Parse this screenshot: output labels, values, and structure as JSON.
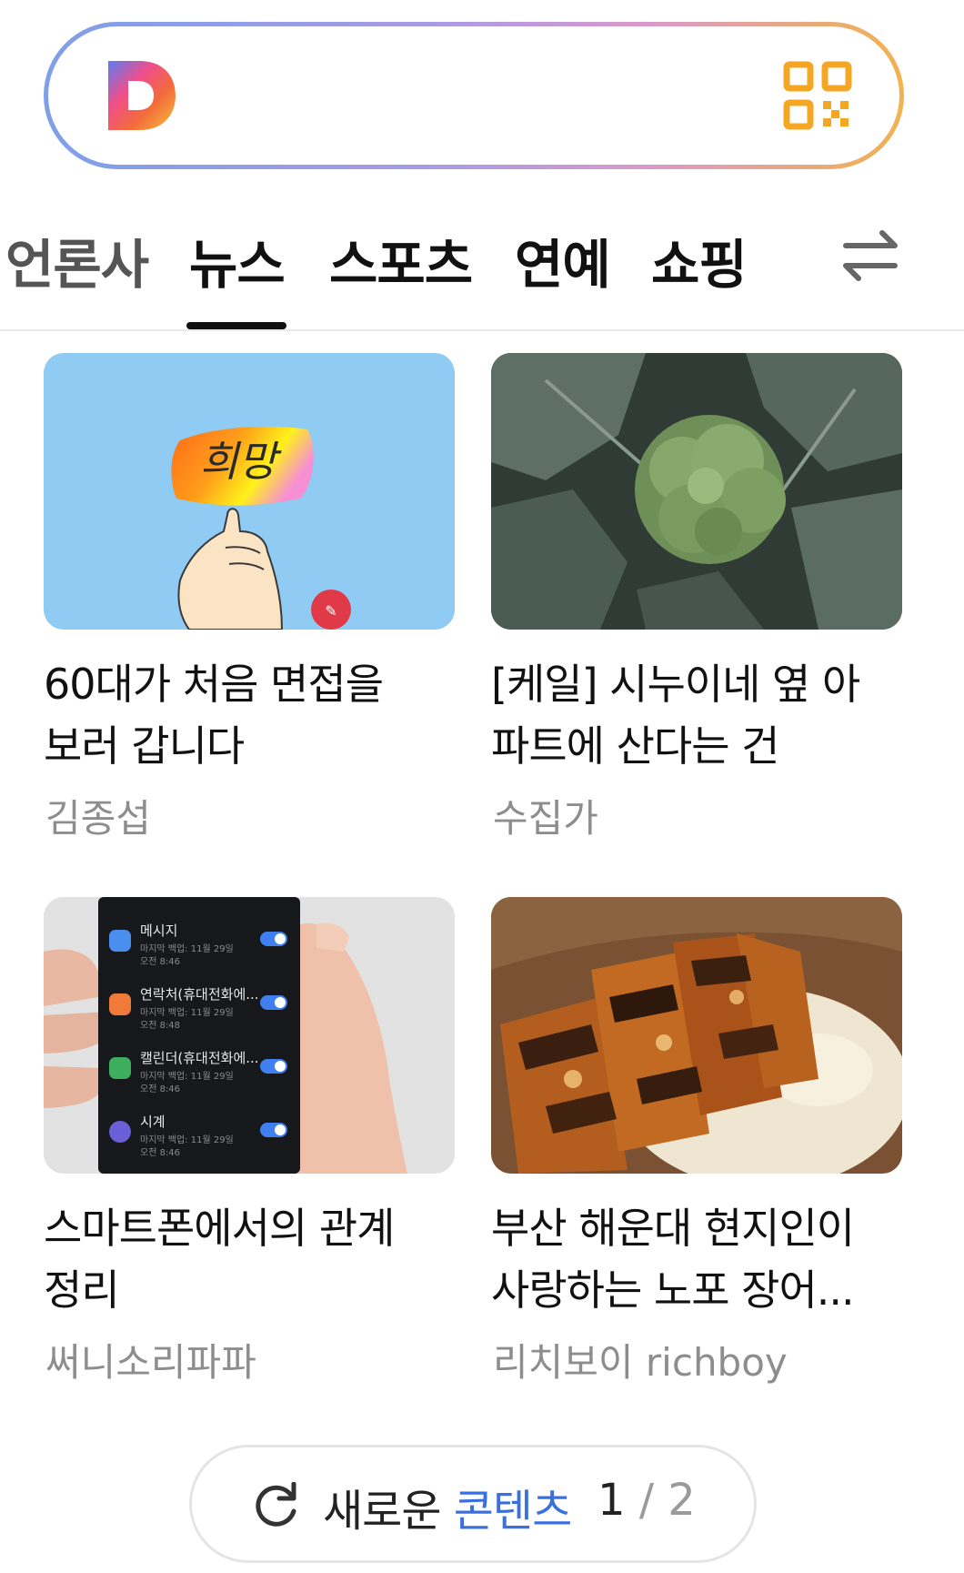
{
  "search": {
    "logo_letter": "D",
    "qr_icon": "qr-code-icon"
  },
  "tabs": {
    "items": [
      {
        "label": "언론사"
      },
      {
        "label": "뉴스",
        "active": true
      },
      {
        "label": "스포츠"
      },
      {
        "label": "연예"
      },
      {
        "label": "쇼핑"
      }
    ],
    "swap_icon": "swap-arrows-icon"
  },
  "cards": [
    {
      "title_line1": "60대가 처음 면접을",
      "title_line2": "보러 갑니다",
      "source": "김종섭",
      "image_text": "희망"
    },
    {
      "title_line1": "[케일] 시누이네 옆 아",
      "title_line2": "파트에 산다는 건",
      "source": "수집가"
    },
    {
      "title_line1": "스마트폰에서의 관계",
      "title_line2": "정리",
      "source": "써니소리파파",
      "phone_items": [
        {
          "name": "메시지",
          "meta": "마지막 백업: 11월 29일",
          "time": "오전 8:46"
        },
        {
          "name": "연락처(휴대전화에...",
          "meta": "마지막 백업: 11월 29일",
          "time": "오전 8:48"
        },
        {
          "name": "캘린더(휴대전화에...",
          "meta": "마지막 백업: 11월 29일",
          "time": "오전 8:46"
        },
        {
          "name": "시계",
          "meta": "마지막 백업: 11월 29일",
          "time": "오전 8:46"
        }
      ]
    },
    {
      "title_line1": "부산 해운대 현지인이",
      "title_line2": "사랑하는 노포 장어...",
      "source": "리치보이 richboy"
    }
  ],
  "refresh": {
    "label_prefix": "새로운",
    "label_accent": "콘텐츠",
    "current_page": "1",
    "separator": "/",
    "total_pages": "2"
  },
  "colors": {
    "accent_blue": "#3a6fe0",
    "source_gray": "#8d8d8d",
    "qr_orange": "#f5a623"
  }
}
